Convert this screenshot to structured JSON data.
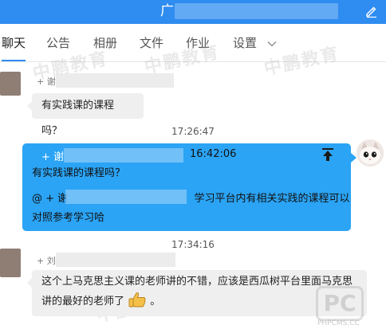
{
  "header": {
    "title": "广",
    "edit_icon": "pencil-icon",
    "color": "#2f8cf0"
  },
  "tabs": [
    {
      "label": "聊天",
      "active": true
    },
    {
      "label": "公告",
      "active": false
    },
    {
      "label": "相册",
      "active": false
    },
    {
      "label": "文件",
      "active": false
    },
    {
      "label": "作业",
      "active": false
    },
    {
      "label": "设置",
      "active": false
    }
  ],
  "messages": [
    {
      "sender": "+ 谢",
      "text": "有实践课的课程吗？"
    },
    {
      "timestamp": "17:26:47"
    },
    {
      "quote_sender": "+ 谢",
      "quote_time": "16:42:06",
      "quote_text": "有实践课的课程吗？",
      "reply_prefix": "@ + 谢",
      "reply_line1_tail": "学习平台内有相关实践的课程可以",
      "reply_line2": "对照参考学习哈",
      "bubble_color": "#2ba4f5"
    },
    {
      "timestamp": "17:34:16"
    },
    {
      "sender": "+ 刘",
      "line1": "这个上马克思主义课的老师讲的不错，应该是西瓜树平台里面马克思",
      "line2": "讲的最好的老师了",
      "line2_tail": "。",
      "emoji": "thumbs-up-icon"
    }
  ],
  "watermarks": [
    "中鹏教育",
    "中鹏教育",
    "中鹏教育",
    "中鹏教育",
    "中鹏教育",
    "中鹏教育",
    "中鹏教育",
    "中鹏教育"
  ],
  "watermark_logo": {
    "mark": "PC",
    "site": "PHPCMS.CC"
  }
}
